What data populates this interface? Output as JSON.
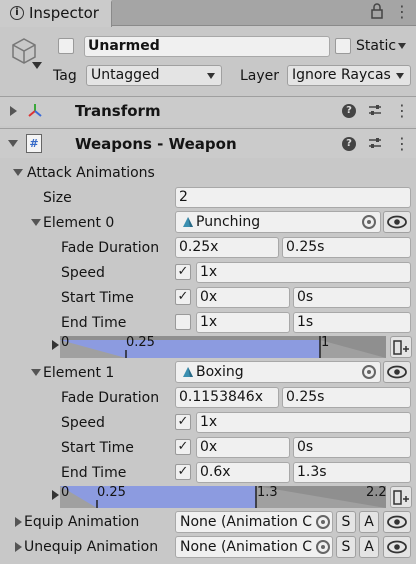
{
  "tab": {
    "title": "Inspector"
  },
  "header": {
    "object_name": "Unarmed",
    "static_label": "Static",
    "tag_label": "Tag",
    "tag_value": "Untagged",
    "layer_label": "Layer",
    "layer_value": "Ignore Raycas"
  },
  "components": {
    "transform": {
      "title": "Transform"
    },
    "weapon": {
      "title": "Weapons - Weapon"
    }
  },
  "attack_animations": {
    "label": "Attack Animations",
    "size_label": "Size",
    "size_value": "2",
    "elements": [
      {
        "label": "Element 0",
        "clip": "Punching",
        "fade_label": "Fade Duration",
        "fade_x": "0.25x",
        "fade_s": "0.25s",
        "speed_label": "Speed",
        "speed_checked": true,
        "speed_value": "1x",
        "start_label": "Start Time",
        "start_checked": true,
        "start_x": "0x",
        "start_s": "0s",
        "end_label": "End Time",
        "end_checked": false,
        "end_x": "1x",
        "end_s": "1s",
        "timeline": {
          "t0": "0",
          "t1": "0.25",
          "t2": "1",
          "t3": ""
        }
      },
      {
        "label": "Element 1",
        "clip": "Boxing",
        "fade_label": "Fade Duration",
        "fade_x": "0.1153846x",
        "fade_s": "0.25s",
        "speed_label": "Speed",
        "speed_checked": true,
        "speed_value": "1x",
        "start_label": "Start Time",
        "start_checked": true,
        "start_x": "0x",
        "start_s": "0s",
        "end_label": "End Time",
        "end_checked": true,
        "end_x": "0.6x",
        "end_s": "1.3s",
        "timeline": {
          "t0": "0",
          "t1": "0.25",
          "t2": "1.3",
          "t3": "2.2"
        }
      }
    ]
  },
  "equip": {
    "label": "Equip Animation",
    "value": "None (Animation C",
    "s": "S",
    "a": "A"
  },
  "unequip": {
    "label": "Unequip Animation",
    "value": "None (Animation C",
    "s": "S",
    "a": "A"
  },
  "icons": {
    "check": "✓",
    "dots": "⋮",
    "help": "?",
    "sliders": "⇆"
  },
  "colors": {
    "timeline_fill": "#8c9be0",
    "timeline_bg": "#8f8f8f"
  }
}
